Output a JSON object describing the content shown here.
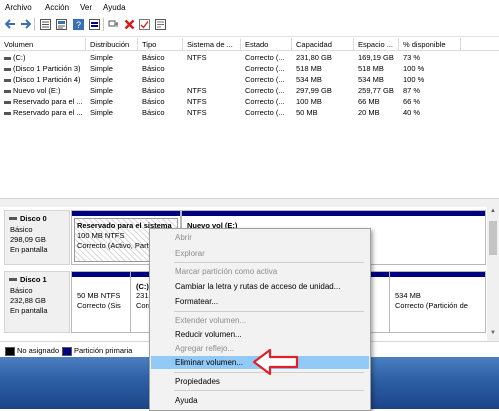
{
  "menu": [
    "Archivo",
    "Acción",
    "Ver",
    "Ayuda"
  ],
  "toolbar_icons": [
    "back-arrow-icon",
    "forward-arrow-icon",
    "list-view-icon",
    "properties-icon",
    "help-icon",
    "disk-view-icon",
    "connect-icon",
    "delete-icon",
    "check-icon",
    "settings-icon"
  ],
  "table": {
    "headers": [
      "Volumen",
      "Distribución",
      "Tipo",
      "Sistema de ...",
      "Estado",
      "Capacidad",
      "Espacio ...",
      "% disponible"
    ],
    "rows": [
      [
        "(C:)",
        "Simple",
        "Básico",
        "NTFS",
        "Correcto (...",
        "231,80 GB",
        "169,19 GB",
        "73 %"
      ],
      [
        "(Disco 1 Partición 3)",
        "Simple",
        "Básico",
        "",
        "Correcto (...",
        "518 MB",
        "518 MB",
        "100 %"
      ],
      [
        "(Disco 1 Partición 4)",
        "Simple",
        "Básico",
        "",
        "Correcto (...",
        "534 MB",
        "534 MB",
        "100 %"
      ],
      [
        "Nuevo vol (E:)",
        "Simple",
        "Básico",
        "NTFS",
        "Correcto (...",
        "297,99 GB",
        "259,77 GB",
        "87 %"
      ],
      [
        "Reservado para el ...",
        "Simple",
        "Básico",
        "NTFS",
        "Correcto (...",
        "100 MB",
        "66 MB",
        "66 %"
      ],
      [
        "Reservado para el ...",
        "Simple",
        "Básico",
        "NTFS",
        "Correcto (...",
        "50 MB",
        "20 MB",
        "40 %"
      ]
    ]
  },
  "disk0": {
    "name": "Disco 0",
    "type": "Básico",
    "size": "298,09 GB",
    "status": "En pantalla",
    "p1": {
      "name": "Reservado para el sistema",
      "info": "100 MB NTFS",
      "status": "Correcto (Activo, Part"
    },
    "p2": {
      "name": "Nuevo vol (E:)"
    }
  },
  "disk1": {
    "name": "Disco 1",
    "type": "Básico",
    "size": "232,88 GB",
    "status": "En pantalla",
    "p1": {
      "info": "50 MB NTFS",
      "status": "Correcto (Sis"
    },
    "p2": {
      "name": "(C:)",
      "info": "231,",
      "status": "Corr"
    },
    "p4": {
      "info": "534 MB",
      "status": "Correcto (Partición de"
    }
  },
  "legend": {
    "unallocated": "No asignado",
    "primary": "Partición primaria"
  },
  "colors": {
    "primary_partition": "#000080",
    "highlight": "#91c9f7",
    "arrow": "#e0202a"
  },
  "context_menu": {
    "open": "Abrir",
    "explore": "Explorar",
    "mark_active": "Marcar partición como activa",
    "change_letter": "Cambiar la letra y rutas de acceso de unidad...",
    "format": "Formatear...",
    "extend": "Extender volumen...",
    "shrink": "Reducir volumen...",
    "add_mirror": "Agregar reflejo...",
    "delete": "Eliminar volumen...",
    "properties": "Propiedades",
    "help": "Ayuda"
  }
}
